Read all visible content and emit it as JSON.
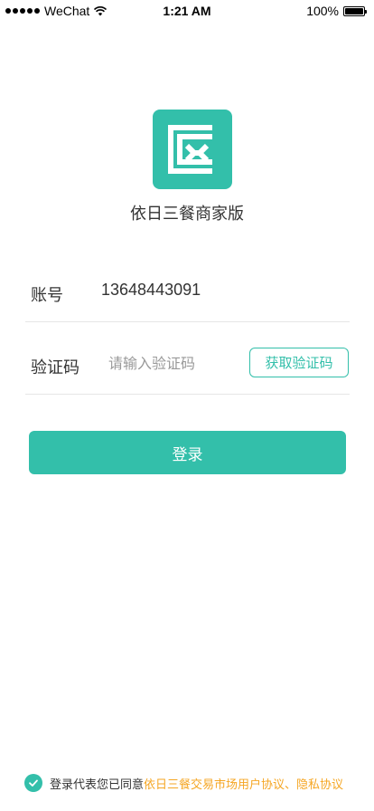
{
  "status_bar": {
    "carrier": "WeChat",
    "time": "1:21 AM",
    "battery": "100%"
  },
  "app": {
    "name": "依日三餐商家版",
    "brand_color": "#33bfaa"
  },
  "form": {
    "account_label": "账号",
    "account_value": "13648443091",
    "code_label": "验证码",
    "code_placeholder": "请输入验证码",
    "get_code_label": "获取验证码",
    "login_label": "登录"
  },
  "agreement": {
    "prefix": "登录代表您已同意",
    "links": "依日三餐交易市场用户协议、隐私协议",
    "link_color": "#f5a623",
    "checked": true
  }
}
